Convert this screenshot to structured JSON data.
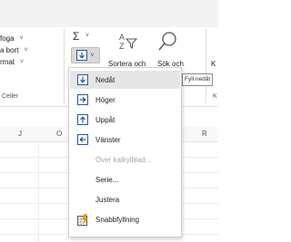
{
  "cells_group": {
    "items": [
      {
        "label": "foga",
        "caret": "˅"
      },
      {
        "label": "a bort",
        "caret": "˅"
      },
      {
        "label": "rmat",
        "caret": "˅"
      }
    ],
    "group_label": "Celler"
  },
  "editing": {
    "sigma": "Σ",
    "sigma_caret": "˅",
    "fill_caret": "˅",
    "sort_label": "Sortera och",
    "find_label": "Sök och",
    "edge_letter": "K",
    "edge_letter2": "K"
  },
  "tooltip": "Fyll nedåt",
  "grid": {
    "columns": [
      "J",
      "O",
      "R"
    ]
  },
  "fill_menu": {
    "items": [
      {
        "label": "Nedåt",
        "icon": "fill-down-icon",
        "state": "active"
      },
      {
        "label": "Höger",
        "icon": "fill-right-icon",
        "state": "normal"
      },
      {
        "label": "Uppåt",
        "icon": "fill-up-icon",
        "state": "normal"
      },
      {
        "label": "Vänster",
        "icon": "fill-left-icon",
        "state": "normal"
      },
      {
        "label": "Över kalkylblad...",
        "icon": "",
        "state": "disabled"
      },
      {
        "label": "Serie...",
        "icon": "",
        "state": "normal"
      },
      {
        "label": "Justera",
        "icon": "",
        "state": "normal"
      },
      {
        "label": "Snabbfyllning",
        "icon": "flash-fill-icon",
        "state": "normal"
      }
    ]
  },
  "colors": {
    "accent": "#2b579a",
    "active_bg": "#e6e6e6",
    "button_bg": "#d9d9d9",
    "disabled_text": "#a6a6a6"
  }
}
